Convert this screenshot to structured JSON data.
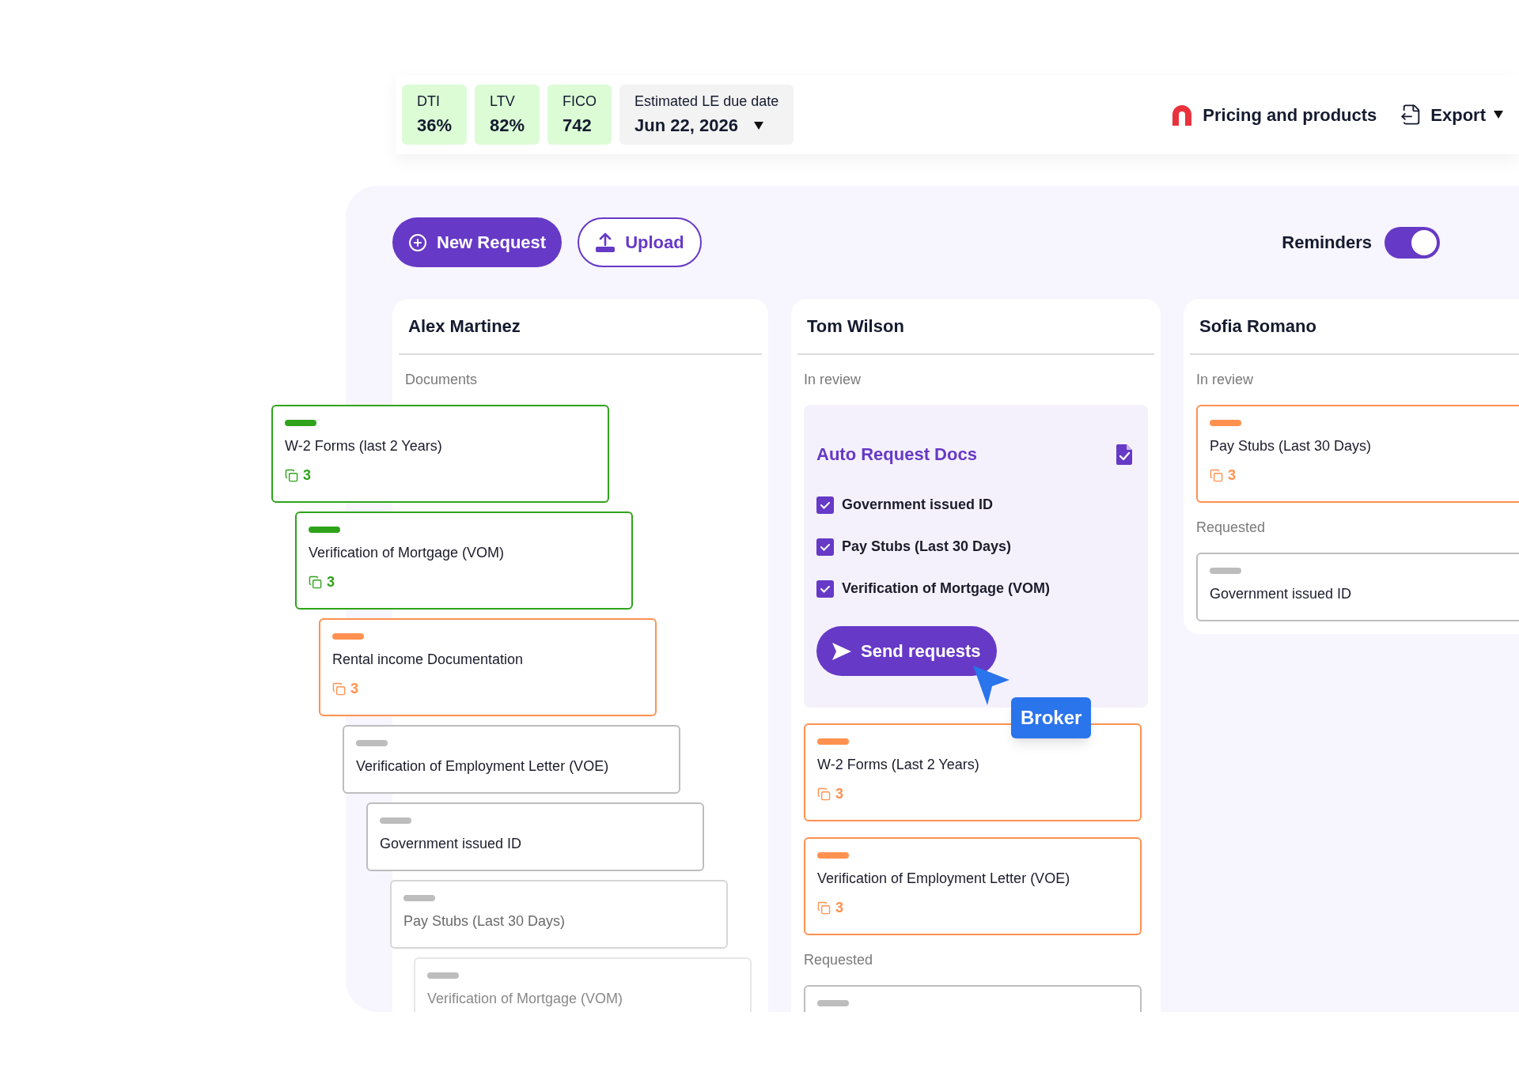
{
  "metrics": [
    {
      "label": "DTI",
      "value": "36%"
    },
    {
      "label": "LTV",
      "value": "82%"
    },
    {
      "label": "FICO",
      "value": "742"
    }
  ],
  "due_date": {
    "label": "Estimated LE due date",
    "value": "Jun 22, 2026"
  },
  "header_actions": [
    {
      "kind": "pricing",
      "label": "Pricing and products"
    },
    {
      "kind": "export",
      "label": "Export"
    }
  ],
  "toolbar": {
    "new_request": "New Request",
    "upload": "Upload",
    "reminders": {
      "label": "Reminders",
      "on": true
    }
  },
  "columns": [
    {
      "name": "Alex Martinez",
      "sections": [
        {
          "title": "Documents",
          "cards": [
            {
              "title": "W-2 Forms (last 2 Years)",
              "color": "#2ea31a",
              "count": "3"
            },
            {
              "title": "Verification of Mortgage (VOM)",
              "color": "#2ea31a",
              "count": "3"
            },
            {
              "title": "Rental income Documentation",
              "color": "#ff9150",
              "count": "3"
            },
            {
              "title": "Verification of Employment Letter (VOE)",
              "color": "#bdbdbd"
            },
            {
              "title": "Government issued ID",
              "color": "#bdbdbd"
            },
            {
              "title": "Pay Stubs (Last 30 Days)",
              "color": "#bdbdbd"
            },
            {
              "title": "Verification of Mortgage (VOM)",
              "color": "#bdbdbd"
            }
          ]
        }
      ]
    },
    {
      "name": "Tom Wilson",
      "sections": [
        {
          "title": "In review",
          "auto_request": {
            "title": "Auto Request Docs",
            "items": [
              {
                "label": "Government issued ID",
                "checked": true
              },
              {
                "label": "Pay Stubs (Last 30 Days)",
                "checked": true
              },
              {
                "label": "Verification of Mortgage (VOM)",
                "checked": true
              }
            ],
            "button": "Send requests",
            "cursor_label": "Broker"
          },
          "cards": [
            {
              "title": "W-2 Forms (Last 2 Years)",
              "color": "#ff9150",
              "count": "3"
            },
            {
              "title": "Verification of Employment Letter (VOE)",
              "color": "#ff9150",
              "count": "3"
            }
          ]
        },
        {
          "title": "Requested",
          "cards": [
            {
              "color": "#bdbdbd"
            }
          ]
        }
      ]
    },
    {
      "name": "Sofia Romano",
      "sections": [
        {
          "title": "In review",
          "cards": [
            {
              "title": "Pay Stubs (Last 30 Days)",
              "color": "#ff9150",
              "count": "3"
            }
          ]
        },
        {
          "title": "Requested",
          "cards": [
            {
              "title": "Government issued ID",
              "color": "#bdbdbd"
            }
          ]
        }
      ]
    }
  ]
}
